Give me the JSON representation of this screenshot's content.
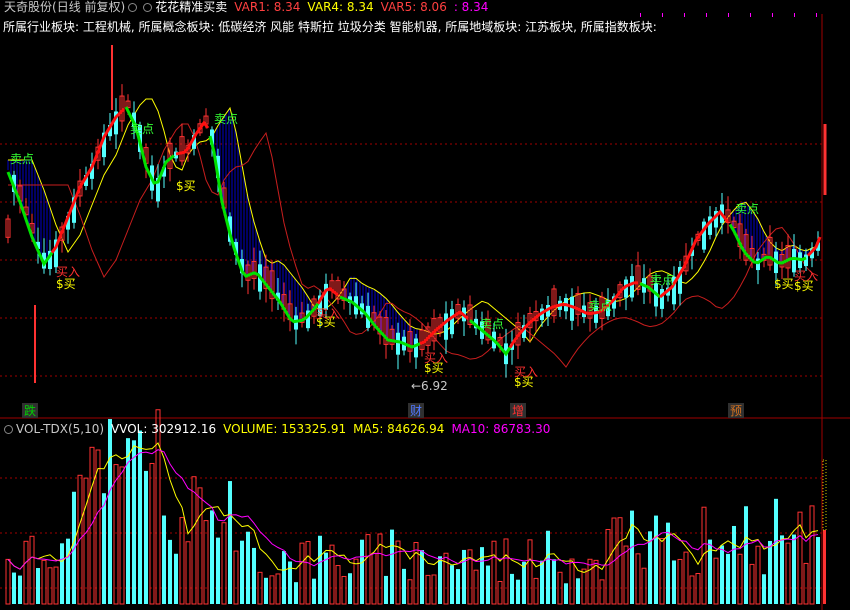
{
  "header": {
    "stock": "天奇股份",
    "mode": "(日线 前复权)",
    "indicator": "花花精准买卖",
    "var1": "VAR1: 8.34",
    "var4": "VAR4: 8.34",
    "var5": "VAR5: 8.06",
    "extra": ": 8.34",
    "colors": {
      "stock": "#c8c8c8",
      "indicator": "#ffffff",
      "var1": "#ff4040",
      "var4": "#ffff00",
      "var5": "#ff4040",
      "extra": "#ff00ff"
    }
  },
  "info_line": "所属行业板块: 工程机械, 所属概念板块: 低碳经济 风能 特斯拉 垃圾分类 智能机器, 所属地域板块: 江苏板块, 所属指数板块:",
  "volume": {
    "name": "VOL-TDX(5,10)",
    "vvol": "VVOL: 302912.16",
    "volume": "VOLUME: 153325.91",
    "ma5": "MA5: 84626.94",
    "ma10": "MA10: 86783.30",
    "colors": {
      "name": "#c8c8c8",
      "vvol": "#ffffff",
      "volume": "#ffff00",
      "ma5": "#ffff00",
      "ma10": "#ff00ff"
    }
  },
  "signals": {
    "sell": "卖点",
    "buy": "$买",
    "buy_in": "买入"
  },
  "low_price_label": "←6.92",
  "event_markers": [
    {
      "text": "跌",
      "color": "#00d000"
    },
    {
      "text": "财",
      "color": "#5078ff"
    },
    {
      "text": "增",
      "color": "#ff3030"
    },
    {
      "text": "预",
      "color": "#d07020"
    }
  ],
  "colors": {
    "up": "#ff3232",
    "down": "#54ffff",
    "grid": "#a00000",
    "ma_yellow": "#ffff00",
    "ma_red": "#c81e1e",
    "trend_green": "#00e000",
    "trend_red": "#ff1010",
    "fill_blue": "#0000c8",
    "sell_text": "#33ff33",
    "buy_text": "#ffff00",
    "buyin_text": "#ff3030"
  }
}
